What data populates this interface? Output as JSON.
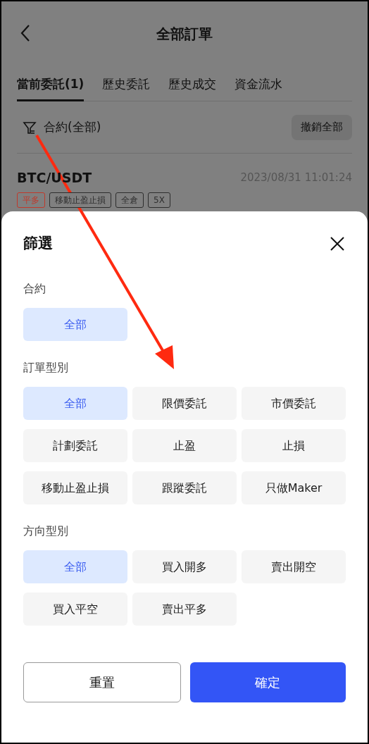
{
  "header": {
    "title": "全部訂單"
  },
  "tabs": [
    {
      "label": "當前委託(1)",
      "selected": true
    },
    {
      "label": "歷史委託",
      "selected": false
    },
    {
      "label": "歷史成交",
      "selected": false
    },
    {
      "label": "資金流水",
      "selected": false
    }
  ],
  "filter_bar": {
    "label": "合約(全部)",
    "cancel_all": "撤銷全部"
  },
  "order": {
    "pair": "BTC/USDT",
    "time": "2023/08/31 11:01:24",
    "tags": [
      {
        "label": "平多",
        "color": "#c0392b"
      },
      {
        "label": "移動止盈止損",
        "color": "#2e2e2e"
      },
      {
        "label": "全倉",
        "color": "#2e2e2e"
      },
      {
        "label": "5X",
        "color": "#2e2e2e"
      }
    ]
  },
  "sheet": {
    "title": "篩選",
    "sections": [
      {
        "label": "合約",
        "options": [
          {
            "label": "全部",
            "selected": true
          }
        ]
      },
      {
        "label": "訂單型別",
        "options": [
          {
            "label": "全部",
            "selected": true
          },
          {
            "label": "限價委託",
            "selected": false
          },
          {
            "label": "市價委託",
            "selected": false
          },
          {
            "label": "計劃委託",
            "selected": false
          },
          {
            "label": "止盈",
            "selected": false
          },
          {
            "label": "止損",
            "selected": false
          },
          {
            "label": "移動止盈止損",
            "selected": false
          },
          {
            "label": "跟蹤委託",
            "selected": false
          },
          {
            "label": "只做Maker",
            "selected": false
          }
        ]
      },
      {
        "label": "方向型別",
        "options": [
          {
            "label": "全部",
            "selected": true
          },
          {
            "label": "買入開多",
            "selected": false
          },
          {
            "label": "賣出開空",
            "selected": false
          },
          {
            "label": "買入平空",
            "selected": false
          },
          {
            "label": "賣出平多",
            "selected": false
          }
        ]
      }
    ],
    "reset": "重置",
    "confirm": "確定"
  }
}
